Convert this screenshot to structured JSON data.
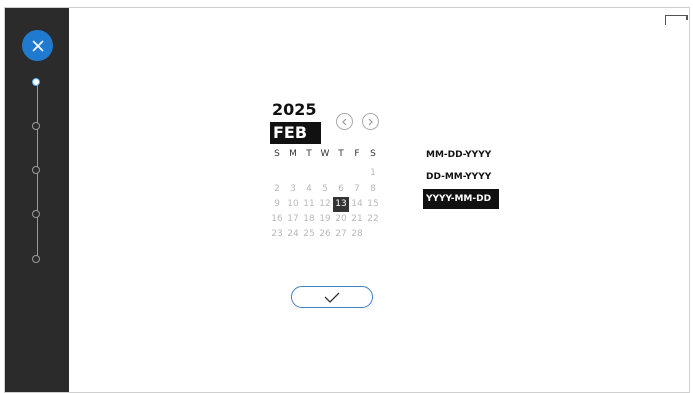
{
  "calendar": {
    "year": "2025",
    "month": "FEB",
    "weekdays": [
      "S",
      "M",
      "T",
      "W",
      "T",
      "F",
      "S"
    ],
    "days": [
      [
        "",
        "",
        "",
        "",
        "",
        "",
        "1"
      ],
      [
        "2",
        "3",
        "4",
        "5",
        "6",
        "7",
        "8"
      ],
      [
        "9",
        "10",
        "11",
        "12",
        "13",
        "14",
        "15"
      ],
      [
        "16",
        "17",
        "18",
        "19",
        "20",
        "21",
        "22"
      ],
      [
        "23",
        "24",
        "25",
        "26",
        "27",
        "28",
        ""
      ]
    ],
    "selected_day": "13"
  },
  "formats": [
    "MM-DD-YYYY",
    "DD-MM-YYYY",
    "YYYY-MM-DD"
  ],
  "selected_format": "YYYY-MM-DD",
  "stepper": {
    "steps": 5,
    "active_step": 1
  },
  "icons": {
    "close": "close-icon",
    "prev": "chevron-left-icon",
    "next": "chevron-right-icon",
    "confirm": "checkmark-icon",
    "corner": "window-corner-icon"
  },
  "colors": {
    "accent": "#1f7ad0",
    "sidebar": "#2b2b2b",
    "selected": "#333333"
  }
}
